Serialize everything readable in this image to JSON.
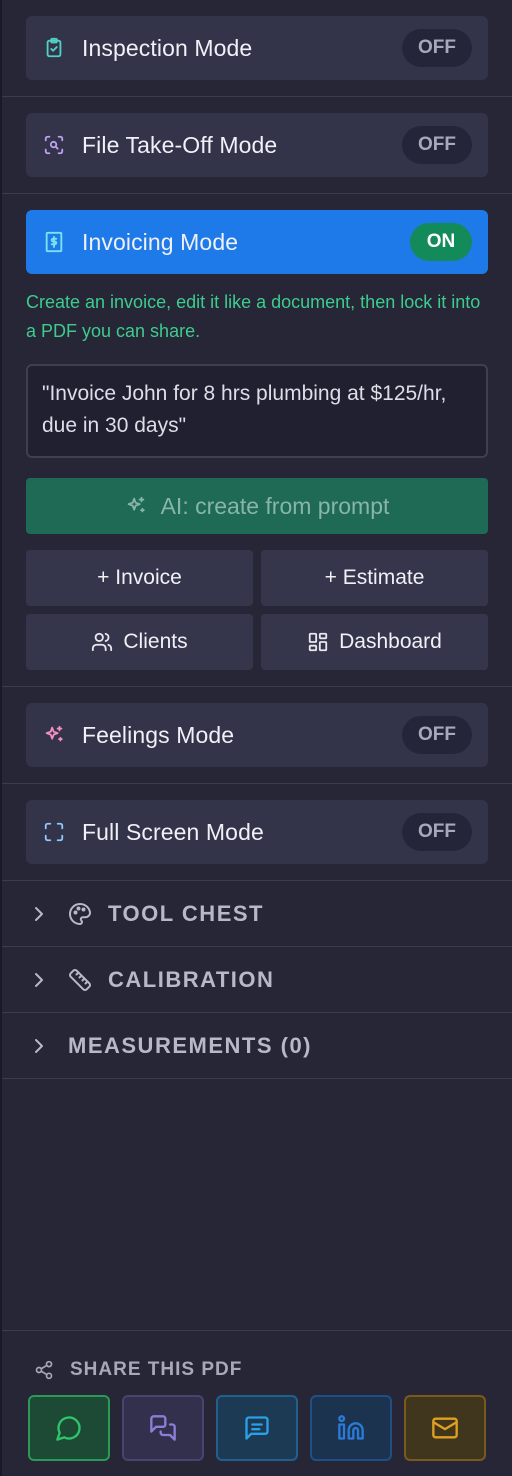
{
  "modes": {
    "inspection": {
      "label": "Inspection Mode",
      "state": "OFF",
      "icon": "clipboard-check-icon",
      "icon_color": "#4fd1c5"
    },
    "takeoff": {
      "label": "File Take-Off Mode",
      "state": "OFF",
      "icon": "scan-search-icon",
      "icon_color": "#c0a0f0"
    },
    "invoicing": {
      "label": "Invoicing Mode",
      "state": "ON",
      "icon": "receipt-dollar-icon",
      "icon_color": "#7de3f0"
    },
    "feelings": {
      "label": "Feelings Mode",
      "state": "OFF",
      "icon": "sparkles-icon",
      "icon_color": "#f48fc0"
    },
    "fullscreen": {
      "label": "Full Screen Mode",
      "state": "OFF",
      "icon": "maximize-icon",
      "icon_color": "#8cc8f8"
    }
  },
  "invoicing": {
    "description": "Create an invoice, edit it like a document, then lock it into a PDF you can share.",
    "prompt_placeholder": "\"Invoice John for 8 hrs plumbing at $125/hr, due in 30 days\"",
    "ai_button": "AI: create from prompt",
    "buttons": {
      "invoice": "+ Invoice",
      "estimate": "+ Estimate",
      "clients": "Clients",
      "dashboard": "Dashboard"
    }
  },
  "sections": {
    "tool_chest": "TOOL CHEST",
    "calibration": "CALIBRATION",
    "measurements": "MEASUREMENTS (0)"
  },
  "share": {
    "title": "SHARE THIS PDF",
    "buttons": [
      {
        "name": "whatsapp",
        "icon": "whatsapp-icon",
        "color": "#2fc46a"
      },
      {
        "name": "chat",
        "icon": "messages-icon",
        "color": "#8a7fd8"
      },
      {
        "name": "sms",
        "icon": "message-square-icon",
        "color": "#2aa0e8"
      },
      {
        "name": "linkedin",
        "icon": "linkedin-icon",
        "color": "#2a7ad8"
      },
      {
        "name": "email",
        "icon": "mail-icon",
        "color": "#e0a020"
      }
    ]
  },
  "colors": {
    "accent": "#1e7ae8",
    "on_toggle": "#138a5a",
    "description_text": "#3dcc8e"
  }
}
